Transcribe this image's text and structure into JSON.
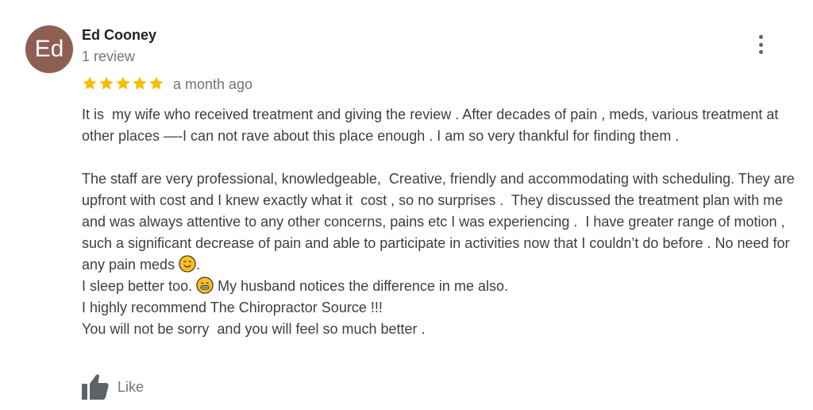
{
  "reviewer": {
    "avatar_initials": "Ed",
    "avatar_color": "#8c5f52",
    "name": "Ed Cooney",
    "review_count": "1 review"
  },
  "rating": {
    "stars": 5,
    "max_stars": 5,
    "star_color": "#fbbc04",
    "time_ago": "a month ago"
  },
  "review_text": {
    "para1": "It is  my wife who received treatment and giving the review . After decades of pain , meds, various treatment at other places —-I can not rave about this place enough . I am so very thankful for finding them .",
    "para2_before_emoji": "The staff are very professional, knowledgeable,  Creative, friendly and accommodating with scheduling. They are upfront with cost and I knew exactly what it  cost , so no surprises .  They discussed the treatment plan with me and was always attentive to any other concerns, pains etc I was experiencing .  I have greater range of motion , such a significant decrease of pain and able to participate in activities now that I couldn’t do before . No need for any pain meds ",
    "para2_after_emoji": ".",
    "line_sleep_before": "I sleep better too. ",
    "line_sleep_after": " My husband notices the difference in me also.",
    "line_recommend": "I highly recommend The Chiropractor Source !!!",
    "line_closing": "You will not be sorry  and you will feel so much better ."
  },
  "emojis": {
    "smile": "smiling-face-emoji",
    "grin": "grinning-face-emoji"
  },
  "actions": {
    "like_label": "Like",
    "more_icon": "more-vert-icon"
  }
}
